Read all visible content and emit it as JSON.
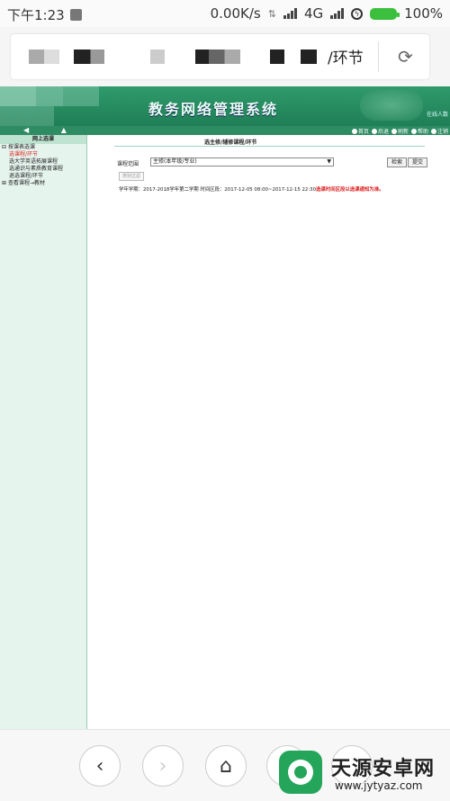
{
  "status_bar": {
    "time": "下午1:23",
    "network_speed": "0.00K/s",
    "network_type": "4G",
    "battery": "100%",
    "battery_level": 1.0
  },
  "browser": {
    "url_tail": "/环节"
  },
  "app": {
    "title": "教务网络管理系统",
    "online_text": "在线人数",
    "nav_links": [
      "首页",
      "后退",
      "刷新",
      "帮助",
      "注销"
    ]
  },
  "sidebar": {
    "header": "网上选课",
    "items": [
      {
        "label": "按课表选课",
        "level": 0
      },
      {
        "label": "选课程/环节",
        "level": 1
      },
      {
        "label": "选大学英语拓展课程",
        "level": 1
      },
      {
        "label": "选通识与素质教育课程",
        "level": 1
      },
      {
        "label": "退选课程/环节",
        "level": 1
      },
      {
        "label": "查看课程→教材",
        "level": 0
      }
    ]
  },
  "main": {
    "page_title": "选主修/辅修课程/环节",
    "course_range_label": "课程范围",
    "course_range_value": "主修(本年级/专业)",
    "search_button": "检索",
    "submit_button": "提交",
    "filter_button": "类别过滤",
    "info_text": "学年学期：2017-2018学年第二学期  时间区段：2017-12-05 08:00~2017-12-15 22:30",
    "info_warning": "选课时间区段以选课通知为准。"
  },
  "bottom_nav": {
    "watermark_name": "天源安卓网",
    "watermark_url": "www.jytyaz.com"
  },
  "colors": {
    "header_green": "#2f9b6c",
    "warning_red": "#e01c1c",
    "battery_green": "#3cbf3c"
  }
}
